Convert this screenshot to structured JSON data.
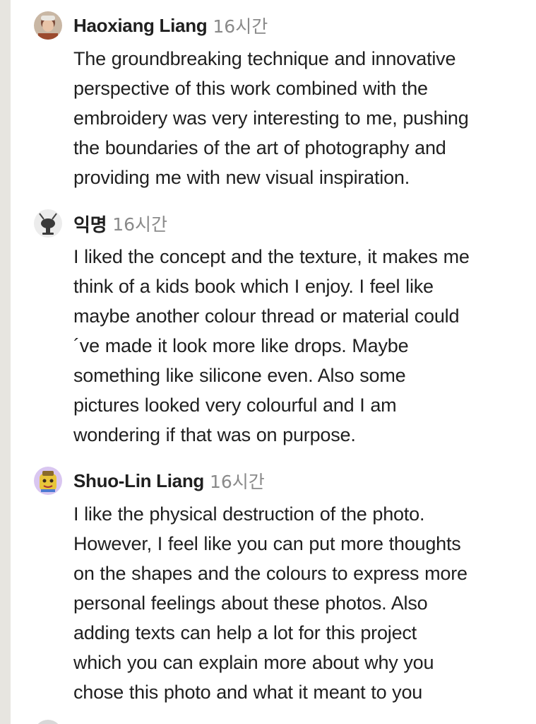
{
  "comments": [
    {
      "author": "Haoxiang Liang",
      "time": "16시간",
      "avatar_icon": "user-photo-avatar",
      "lines": [
        "The groundbreaking technique and innovative",
        "perspective of this work combined with the",
        "embroidery was very interesting to me, pushing",
        "the boundaries of the art of photography and",
        "providing me with new visual inspiration."
      ]
    },
    {
      "author": "익명",
      "time": "16시간",
      "avatar_icon": "anonymous-ant-avatar",
      "lines": [
        "I liked the concept and the texture, it makes me",
        "think of a kids book which I enjoy. I feel like",
        "maybe another colour thread or material could",
        "´ve made it look more like drops. Maybe",
        "something like silicone even. Also some",
        "pictures looked very colourful and I am",
        "wondering if that was on purpose."
      ]
    },
    {
      "author": "Shuo-Lin Liang",
      "time": "16시간",
      "avatar_icon": "cartoon-character-avatar",
      "lines": [
        "I like the physical destruction of the photo.",
        "However, I feel like you can put more thoughts",
        "on the shapes and the colours to express more",
        "personal feelings about these photos. Also",
        "adding texts can help a lot for this project",
        "which you can explain more about why you",
        "chose this photo and what it meant to you"
      ]
    }
  ]
}
